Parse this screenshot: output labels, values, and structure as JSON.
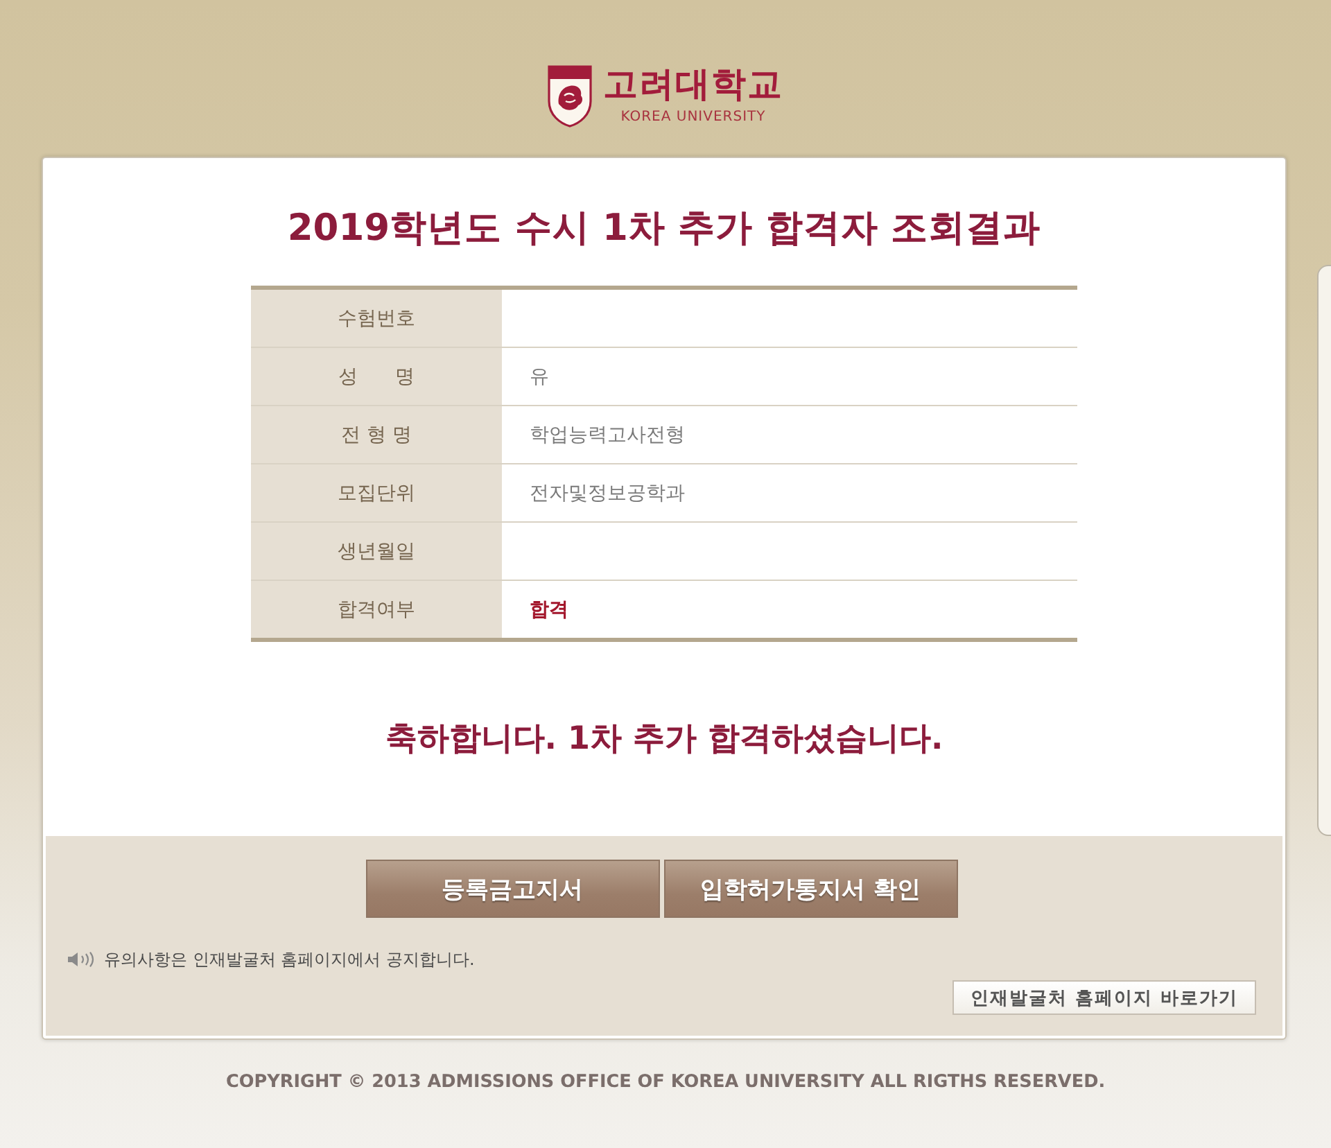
{
  "header": {
    "logo_name": "고려대학교",
    "logo_subtitle": "KOREA UNIVERSITY"
  },
  "result": {
    "title": "2019학년도 수시 1차 추가 합격자 조회결과",
    "rows": [
      {
        "label": "수험번호"
      },
      {
        "label": "성      명",
        "kind": "text",
        "value": "유"
      },
      {
        "label": "전 형 명",
        "kind": "text",
        "value": "학업능력고사전형"
      },
      {
        "label": "모집단위",
        "kind": "text",
        "value": "전자및정보공학과"
      },
      {
        "label": "생년월일"
      },
      {
        "label": "합격여부",
        "kind": "status",
        "value": "합격"
      }
    ],
    "message": "축하합니다. 1차 추가 합격하셨습니다."
  },
  "actions": {
    "buttons": [
      "등록금고지서",
      "입학허가통지서 확인"
    ],
    "notice": "유의사항은 인재발굴처 홈페이지에서 공지합니다.",
    "link": "인재발굴처 홈페이지 바로가기"
  },
  "footer": {
    "copyright": "COPYRIGHT © 2013 ADMISSIONS OFFICE OF KOREA UNIVERSITY ALL RIGTHS RESERVED."
  }
}
